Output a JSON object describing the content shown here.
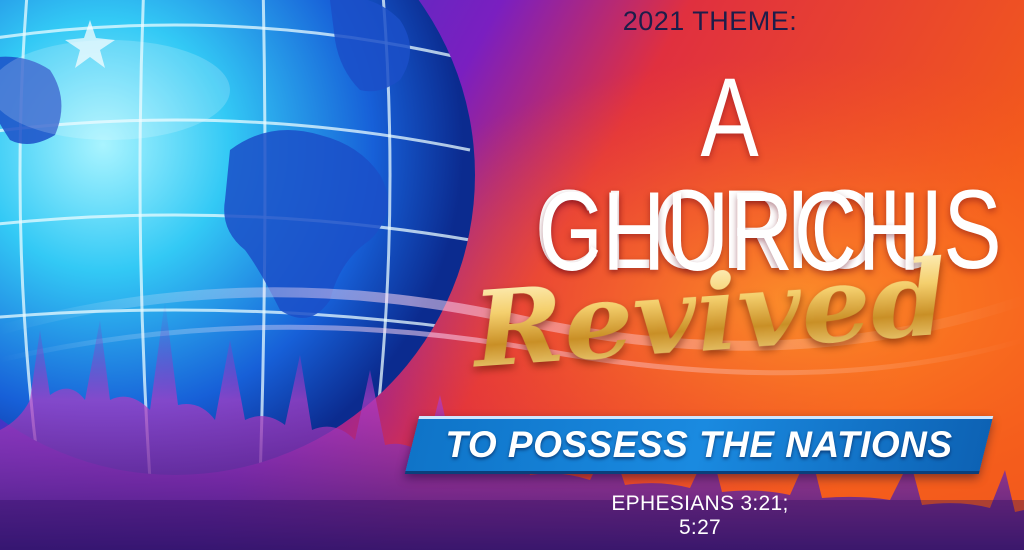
{
  "poster": {
    "theme_label": "2021 THEME:",
    "headline_line1": "A GLORIOUS",
    "headline_line2": "CHURCH",
    "script_word": "Revived",
    "banner_text": "TO POSSESS THE NATIONS",
    "scripture": "EPHESIANS 3:21; 5:27"
  },
  "colors": {
    "background_left": "#1a4fd8",
    "background_right": "#f04a1f",
    "globe": "#3ac6f2",
    "banner": "#1580d8",
    "gold": "#f1c862",
    "theme_label": "#1d1d4a"
  },
  "icons": [
    "globe-illustration",
    "crowd-silhouette"
  ]
}
